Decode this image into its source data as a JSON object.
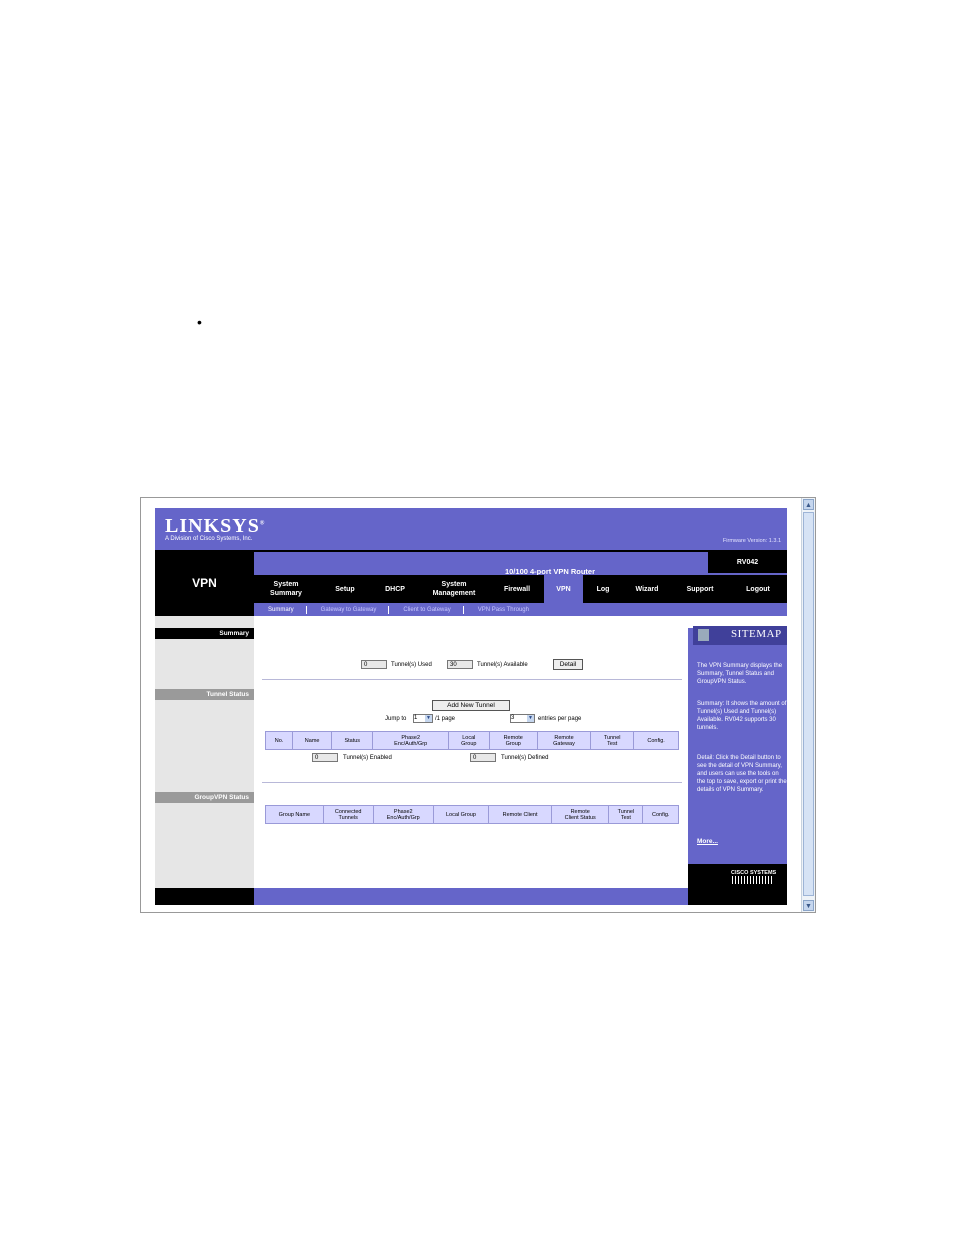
{
  "document": {
    "bullet": "•"
  },
  "header": {
    "logo": "LINKSYS",
    "logo_mark": "®",
    "logo_sub": "A Division of Cisco Systems, Inc.",
    "firmware": "Firmware Version: 1.3.1",
    "product_name": "10/100 4-port VPN Router",
    "model": "RV042",
    "section_title": "VPN"
  },
  "tabs": [
    {
      "label": "System\nSummary"
    },
    {
      "label": "Setup"
    },
    {
      "label": "DHCP"
    },
    {
      "label": "System\nManagement"
    },
    {
      "label": "Firewall"
    },
    {
      "label": "VPN"
    },
    {
      "label": "Log"
    },
    {
      "label": "Wizard"
    },
    {
      "label": "Support"
    },
    {
      "label": "Logout"
    }
  ],
  "subtabs": [
    {
      "label": "Summary"
    },
    {
      "label": "Gateway to Gateway"
    },
    {
      "label": "Client to Gateway"
    },
    {
      "label": "VPN Pass Through"
    }
  ],
  "left_headers": {
    "summary": "Summary",
    "tunnel_status": "Tunnel Status",
    "groupvpn_status": "GroupVPN Status"
  },
  "summary": {
    "used_value": "0",
    "used_label": "Tunnel(s) Used",
    "available_value": "30",
    "available_label": "Tunnel(s) Available",
    "detail_button": "Detail"
  },
  "tunnel_status": {
    "add_button": "Add New Tunnel",
    "jump_label": "Jump to",
    "jump_value": "1",
    "page_suffix": "/1 page",
    "entries_value": "3",
    "entries_label": "entries per page",
    "columns": [
      "No.",
      "Name",
      "Status",
      "Phase2\nEnc/Auth/Grp",
      "Local\nGroup",
      "Remote\nGroup",
      "Remote\nGateway",
      "Tunnel\nTest",
      "Config."
    ],
    "enabled_value": "0",
    "enabled_label": "Tunnel(s) Enabled",
    "defined_value": "0",
    "defined_label": "Tunnel(s) Defined"
  },
  "groupvpn": {
    "columns": [
      "Group Name",
      "Connected\nTunnels",
      "Phase2\nEnc/Auth/Grp",
      "Local Group",
      "Remote Client",
      "Remote\nClient Status",
      "Tunnel\nTest",
      "Config."
    ]
  },
  "sitemap": {
    "title": "SITEMAP",
    "p1": "The VPN Summary displays the Summary, Tunnel Status and GroupVPN Status.",
    "p2": "Summary: It shows the amount of Tunnel(s) Used and Tunnel(s) Available. RV042 supports 30 tunnels.",
    "p3": "Detail: Click the Detail button to see the detail of VPN Summary, and users can use the tools on the top to save, export or print the details of VPN Summary.",
    "more": "More...",
    "cisco": "CISCO SYSTEMS"
  },
  "colors": {
    "accent": "#6565c9",
    "black": "#000000",
    "grey_panel": "#e6e6e6",
    "table_header": "#d8d8ff"
  },
  "icons": [
    "scroll-up-arrow-icon",
    "scroll-down-arrow-icon",
    "chevron-down-icon",
    "sitemap-icon",
    "cisco-logo-icon"
  ]
}
